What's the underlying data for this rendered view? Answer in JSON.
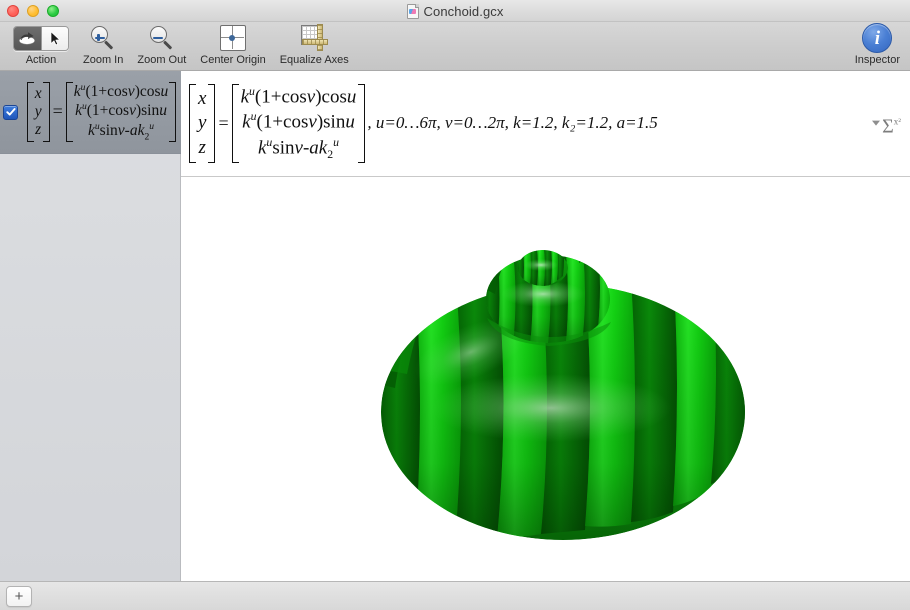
{
  "window": {
    "title": "Conchoid.gcx",
    "doc_icon": "document-icon",
    "traffic_lights": [
      "close",
      "minimize",
      "maximize"
    ]
  },
  "toolbar": {
    "items": [
      {
        "id": "action",
        "label": "Action",
        "icon": "rotate-hand-icon"
      },
      {
        "id": "zoom-in",
        "label": "Zoom In",
        "icon": "magnifier-plus-icon"
      },
      {
        "id": "zoom-out",
        "label": "Zoom Out",
        "icon": "magnifier-minus-icon"
      },
      {
        "id": "center-origin",
        "label": "Center Origin",
        "icon": "crosshair-origin-icon"
      },
      {
        "id": "equalize-axes",
        "label": "Equalize Axes",
        "icon": "rulers-grid-icon"
      }
    ],
    "action_segments": [
      {
        "id": "rotate",
        "icon": "rotate-hand-icon",
        "selected": true
      },
      {
        "id": "select",
        "icon": "arrow-cursor-icon",
        "selected": false
      }
    ],
    "inspector": {
      "label": "Inspector",
      "icon": "info-circle-icon",
      "accent": "#3366bf"
    }
  },
  "sidebar": {
    "rows": [
      {
        "checked": true,
        "selected": true,
        "formula_id": "conchoid"
      }
    ]
  },
  "formula_bar": {
    "lhs": [
      "x",
      "y",
      "z"
    ],
    "rhs": [
      {
        "base": "k",
        "exp": "u",
        "rest": "(1+cos",
        "var": "v",
        "tail": ")cos",
        "var2": "u"
      },
      {
        "base": "k",
        "exp": "u",
        "rest": "(1+cos",
        "var": "v",
        "tail": ")sin",
        "var2": "u"
      },
      {
        "base": "k",
        "exp": "u",
        "rest": "sin",
        "var": "v",
        "tail": "-a",
        "var2": "k",
        "sub2": "2",
        "exp2": "u"
      }
    ],
    "rhs_text": [
      "k^u(1+cosv)cosu",
      "k^u(1+cosv)sinu",
      "k^u sinv-ak_2^u"
    ],
    "parameters": ", u=0…6π, v=0…2π, k=1.2, k₂=1.2, a=1.5",
    "param_list": [
      {
        "name": "u",
        "range": "0…6π"
      },
      {
        "name": "v",
        "range": "0…2π"
      },
      {
        "name": "k",
        "value": "1.2"
      },
      {
        "name": "k₂",
        "value": "1.2"
      },
      {
        "name": "a",
        "value": "1.5"
      }
    ],
    "math_palette": {
      "icon": "sigma-x-squared-icon",
      "glyph": "Σ",
      "sup": "x²"
    }
  },
  "plot": {
    "surface_name": "conchoid-surface",
    "background": "#ffffff",
    "colors": {
      "stripe_light": "#19e019",
      "stripe_dark": "#0a8a0a",
      "highlight": "#bdf7bd",
      "edge": "#046004"
    }
  },
  "bottom_bar": {
    "add_label": "+",
    "add_icon": "plus-icon"
  }
}
